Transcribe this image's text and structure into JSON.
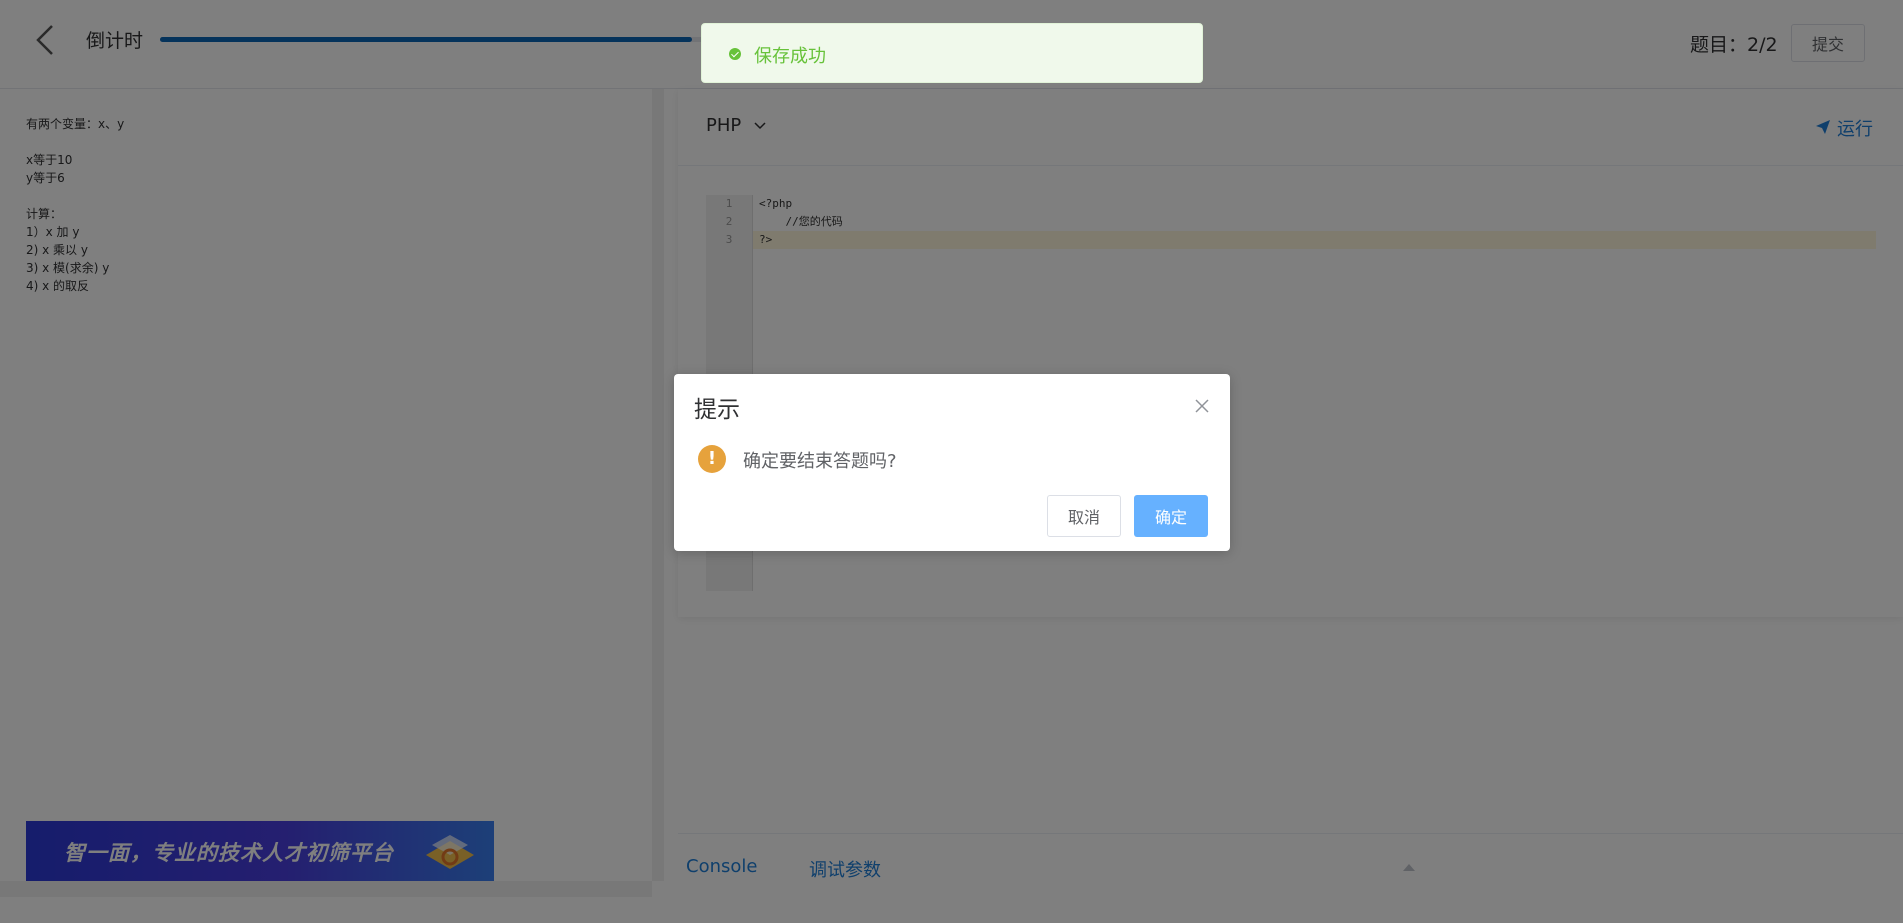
{
  "header": {
    "countdown_label": "倒计时",
    "progress": 0.95,
    "question_counter": "题目：2/2",
    "submit_label": "提交"
  },
  "problem": {
    "lines": [
      "有两个变量：x、y",
      "",
      "x等于10",
      "y等于6",
      "",
      "计算：",
      "1）x 加 y",
      "2) x 乘以 y",
      "3) x 模(求余) y",
      "4) x 的取反"
    ]
  },
  "banner": {
    "text": "智一面，专业的技术人才初筛平台"
  },
  "editor": {
    "language": "PHP",
    "run_label": "运行",
    "line_numbers": [
      "1",
      "2",
      "3"
    ],
    "code_lines": [
      "<?php",
      "    //您的代码",
      "?>"
    ]
  },
  "bottom_tabs": {
    "console": "Console",
    "debug_params": "调试参数"
  },
  "toast": {
    "message": "保存成功"
  },
  "dialog": {
    "title": "提示",
    "message": "确定要结束答题吗?",
    "cancel_label": "取消",
    "confirm_label": "确定"
  },
  "colors": {
    "accent": "#1e7fd8",
    "progress": "#0a66b7",
    "success": "#67c23a",
    "warning": "#e6a23c",
    "primary_light": "#66b1ff"
  }
}
